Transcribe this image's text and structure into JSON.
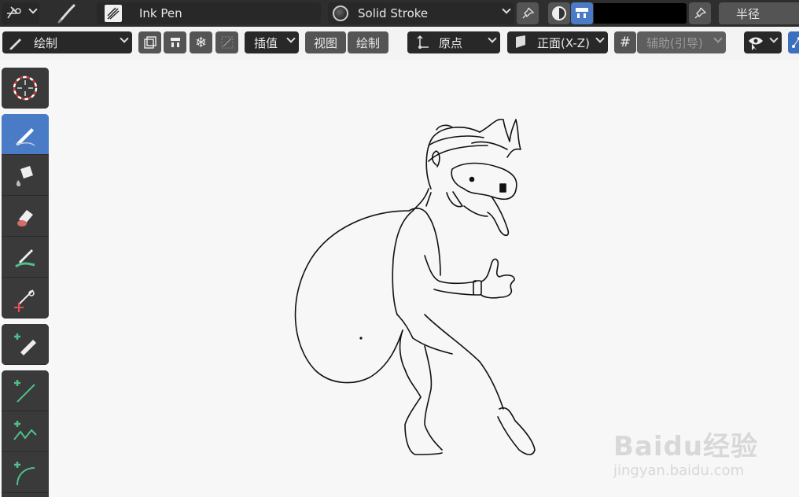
{
  "header": {
    "brush_name": "Ink Pen",
    "material_name": "Solid Stroke",
    "radius_label": "半径",
    "color_swatch": "#000000"
  },
  "toolbar": {
    "mode_label": "绘制",
    "interpolate_label": "插值",
    "view_label": "视图",
    "draw_label": "绘制",
    "origin_label": "原点",
    "plane_label": "正面(X-Z)",
    "guides_label": "辅助(引导)"
  },
  "tools": [
    {
      "name": "cursor"
    },
    {
      "name": "draw"
    },
    {
      "name": "fill"
    },
    {
      "name": "erase"
    },
    {
      "name": "tint"
    },
    {
      "name": "cutter"
    },
    {
      "name": "eyedropper"
    },
    {
      "name": "line"
    },
    {
      "name": "polyline"
    },
    {
      "name": "arc"
    }
  ],
  "watermark": {
    "brand": "Baidu经验",
    "url": "jingyan.baidu.com"
  },
  "colors": {
    "active_tool": "#4a7bc6",
    "header_bg": "#2e2e2e",
    "panel_bg": "#3a3a3a"
  }
}
